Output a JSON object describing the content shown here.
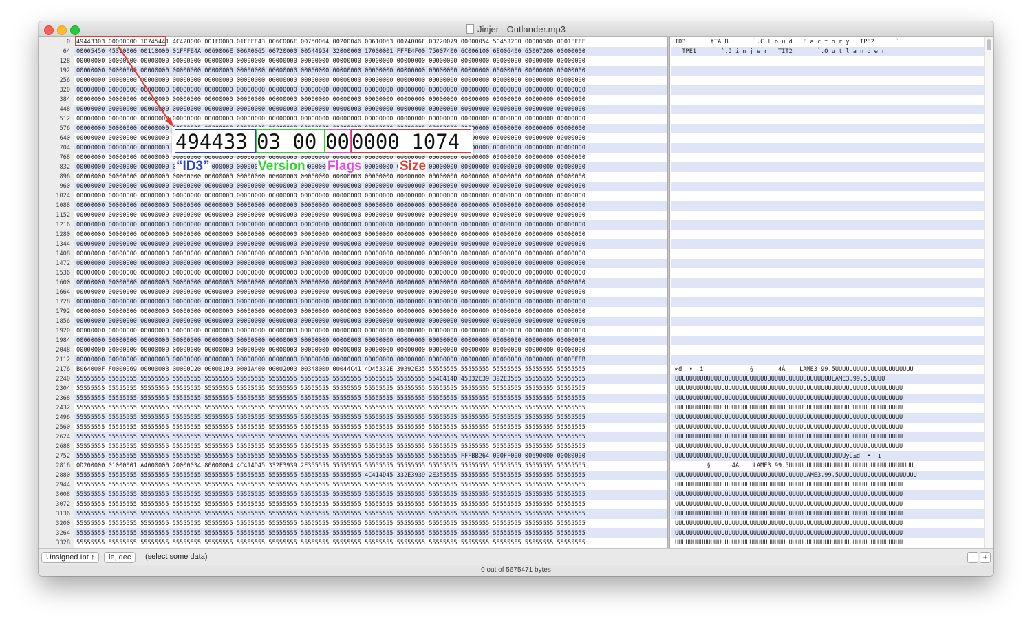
{
  "window": {
    "title": "Jinjer - Outlander.mp3",
    "hex_rows": [
      {
        "offset": "0",
        "hex": "49443303 00000000 10745441 4C420000 001F0000 01FFFE43 006C006F 00750064 00200046 00610063 0074006F 00720079 00000054 50453200 00000500 0001FFFE",
        "ascii": "ID3       tTALB       `.C l o u d   F a c t o r y   TPE2      `."
      },
      {
        "offset": "64",
        "hex": "00005450 45310000 00110000 01FFFE4A 0069006E 006A0065 00720000 00544954 32000000 17000001 FFFE4F00 75007400 6C006100 6E006400 65007200 00000000",
        "ascii": "  TPE1       `.J i n j e r   TIT2       `.O u t l a n d e r"
      },
      {
        "offset": "128",
        "hex": "00000000 00000000 00000000 00000000 00000000 00000000 00000000 00000000 00000000 00000000 00000000 00000000 00000000 00000000 00000000 00000000",
        "ascii": ""
      },
      {
        "offset": "192",
        "hex": "00000000 00000000 00000000 00000000 00000000 00000000 00000000 00000000 00000000 00000000 00000000 00000000 00000000 00000000 00000000 00000000",
        "ascii": ""
      },
      {
        "offset": "256",
        "hex": "00000000 00000000 00000000 00000000 00000000 00000000 00000000 00000000 00000000 00000000 00000000 00000000 00000000 00000000 00000000 00000000",
        "ascii": ""
      },
      {
        "offset": "320",
        "hex": "00000000 00000000 00000000 00000000 00000000 00000000 00000000 00000000 00000000 00000000 00000000 00000000 00000000 00000000 00000000 00000000",
        "ascii": ""
      },
      {
        "offset": "384",
        "hex": "00000000 00000000 00000000 00000000 00000000 00000000 00000000 00000000 00000000 00000000 00000000 00000000 00000000 00000000 00000000 00000000",
        "ascii": ""
      },
      {
        "offset": "448",
        "hex": "00000000 00000000 00000000 00000000 00000000 00000000 00000000 00000000 00000000 00000000 00000000 00000000 00000000 00000000 00000000 00000000",
        "ascii": ""
      },
      {
        "offset": "512",
        "hex": "00000000 00000000 00000000 00000000 00000000 00000000 00000000 00000000 00000000 00000000 00000000 00000000 00000000 00000000 00000000 00000000",
        "ascii": ""
      },
      {
        "offset": "576",
        "hex": "00000000 00000000 00000000 00000000 00000000 00000000 00000000 00000000 00000000 00000000 00000000 00000000 00000000 00000000 00000000 00000000",
        "ascii": ""
      },
      {
        "offset": "640",
        "hex": "00000000 00000000 00000000 00000000 00000000 00000000 00000000 00000000 00000000 00000000 00000000 00000000 00000000 00000000 00000000 00000000",
        "ascii": ""
      },
      {
        "offset": "704",
        "hex": "00000000 00000000 00000000 00000000 00000000 00000000 00000000 00000000 00000000 00000000 00000000 00000000 00000000 00000000 00000000 00000000",
        "ascii": ""
      },
      {
        "offset": "768",
        "hex": "00000000 00000000 00000000 00000000 00000000 00000000 00000000 00000000 00000000 00000000 00000000 00000000 00000000 00000000 00000000 00000000",
        "ascii": ""
      },
      {
        "offset": "832",
        "hex": "00000000 00000000 00000000 00000000 00000000 00000000 00000000 00000000 00000000 00000000 00000000 00000000 00000000 00000000 00000000 00000000",
        "ascii": ""
      },
      {
        "offset": "896",
        "hex": "00000000 00000000 00000000 00000000 00000000 00000000 00000000 00000000 00000000 00000000 00000000 00000000 00000000 00000000 00000000 00000000",
        "ascii": ""
      },
      {
        "offset": "960",
        "hex": "00000000 00000000 00000000 00000000 00000000 00000000 00000000 00000000 00000000 00000000 00000000 00000000 00000000 00000000 00000000 00000000",
        "ascii": ""
      },
      {
        "offset": "1024",
        "hex": "00000000 00000000 00000000 00000000 00000000 00000000 00000000 00000000 00000000 00000000 00000000 00000000 00000000 00000000 00000000 00000000",
        "ascii": ""
      },
      {
        "offset": "1088",
        "hex": "00000000 00000000 00000000 00000000 00000000 00000000 00000000 00000000 00000000 00000000 00000000 00000000 00000000 00000000 00000000 00000000",
        "ascii": ""
      },
      {
        "offset": "1152",
        "hex": "00000000 00000000 00000000 00000000 00000000 00000000 00000000 00000000 00000000 00000000 00000000 00000000 00000000 00000000 00000000 00000000",
        "ascii": ""
      },
      {
        "offset": "1216",
        "hex": "00000000 00000000 00000000 00000000 00000000 00000000 00000000 00000000 00000000 00000000 00000000 00000000 00000000 00000000 00000000 00000000",
        "ascii": ""
      },
      {
        "offset": "1280",
        "hex": "00000000 00000000 00000000 00000000 00000000 00000000 00000000 00000000 00000000 00000000 00000000 00000000 00000000 00000000 00000000 00000000",
        "ascii": ""
      },
      {
        "offset": "1344",
        "hex": "00000000 00000000 00000000 00000000 00000000 00000000 00000000 00000000 00000000 00000000 00000000 00000000 00000000 00000000 00000000 00000000",
        "ascii": ""
      },
      {
        "offset": "1408",
        "hex": "00000000 00000000 00000000 00000000 00000000 00000000 00000000 00000000 00000000 00000000 00000000 00000000 00000000 00000000 00000000 00000000",
        "ascii": ""
      },
      {
        "offset": "1472",
        "hex": "00000000 00000000 00000000 00000000 00000000 00000000 00000000 00000000 00000000 00000000 00000000 00000000 00000000 00000000 00000000 00000000",
        "ascii": ""
      },
      {
        "offset": "1536",
        "hex": "00000000 00000000 00000000 00000000 00000000 00000000 00000000 00000000 00000000 00000000 00000000 00000000 00000000 00000000 00000000 00000000",
        "ascii": ""
      },
      {
        "offset": "1600",
        "hex": "00000000 00000000 00000000 00000000 00000000 00000000 00000000 00000000 00000000 00000000 00000000 00000000 00000000 00000000 00000000 00000000",
        "ascii": ""
      },
      {
        "offset": "1664",
        "hex": "00000000 00000000 00000000 00000000 00000000 00000000 00000000 00000000 00000000 00000000 00000000 00000000 00000000 00000000 00000000 00000000",
        "ascii": ""
      },
      {
        "offset": "1728",
        "hex": "00000000 00000000 00000000 00000000 00000000 00000000 00000000 00000000 00000000 00000000 00000000 00000000 00000000 00000000 00000000 00000000",
        "ascii": ""
      },
      {
        "offset": "1792",
        "hex": "00000000 00000000 00000000 00000000 00000000 00000000 00000000 00000000 00000000 00000000 00000000 00000000 00000000 00000000 00000000 00000000",
        "ascii": ""
      },
      {
        "offset": "1856",
        "hex": "00000000 00000000 00000000 00000000 00000000 00000000 00000000 00000000 00000000 00000000 00000000 00000000 00000000 00000000 00000000 00000000",
        "ascii": ""
      },
      {
        "offset": "1920",
        "hex": "00000000 00000000 00000000 00000000 00000000 00000000 00000000 00000000 00000000 00000000 00000000 00000000 00000000 00000000 00000000 00000000",
        "ascii": ""
      },
      {
        "offset": "1984",
        "hex": "00000000 00000000 00000000 00000000 00000000 00000000 00000000 00000000 00000000 00000000 00000000 00000000 00000000 00000000 00000000 00000000",
        "ascii": ""
      },
      {
        "offset": "2048",
        "hex": "00000000 00000000 00000000 00000000 00000000 00000000 00000000 00000000 00000000 00000000 00000000 00000000 00000000 00000000 00000000 00000000",
        "ascii": ""
      },
      {
        "offset": "2112",
        "hex": "00000000 00000000 00000000 00000000 00000000 00000000 00000000 00000000 00000000 00000000 00000000 00000000 00000000 00000000 00000000 0000FFFB",
        "ascii": ""
      },
      {
        "offset": "2176",
        "hex": "B064000F F0000069 00000008 00000D20 00000100 0001A400 00002000 00348000 00044C41 4D45332E 39392E35 55555555 55555555 55555555 55555555 55555555",
        "ascii": "∞d  •  i             §       4À    LAME3.99.5UUUUUUUUUUUUUUUUUUUUUU"
      },
      {
        "offset": "2240",
        "hex": "55555555 55555555 55555555 55555555 55555555 55555555 55555555 55555555 55555555 55555555 55555555 554C414D 45332E39 392E3555 55555555 55555555",
        "ascii": "UUUUUUUUUUUUUUUUUUUUUUUUUUUUUUUUUUUUUUUUUUUULAME3.99.5UUUUU"
      },
      {
        "offset": "2304",
        "hex": "55555555 55555555 55555555 55555555 55555555 55555555 55555555 55555555 55555555 55555555 55555555 55555555 55555555 55555555 55555555 55555555",
        "ascii": "UUUUUUUUUUUUUUUUUUUUUUUUUUUUUUUUUUUUUUUUUUUUUUUUUUUUUUUUUUUUUUUU"
      },
      {
        "offset": "2368",
        "hex": "55555555 55555555 55555555 55555555 55555555 55555555 55555555 55555555 55555555 55555555 55555555 55555555 55555555 55555555 55555555 55555555",
        "ascii": "UUUUUUUUUUUUUUUUUUUUUUUUUUUUUUUUUUUUUUUUUUUUUUUUUUUUUUUUUUUUUUUU"
      },
      {
        "offset": "2432",
        "hex": "55555555 55555555 55555555 55555555 55555555 55555555 55555555 55555555 55555555 55555555 55555555 55555555 55555555 55555555 55555555 55555555",
        "ascii": "UUUUUUUUUUUUUUUUUUUUUUUUUUUUUUUUUUUUUUUUUUUUUUUUUUUUUUUUUUUUUUUU"
      },
      {
        "offset": "2496",
        "hex": "55555555 55555555 55555555 55555555 55555555 55555555 55555555 55555555 55555555 55555555 55555555 55555555 55555555 55555555 55555555 55555555",
        "ascii": "UUUUUUUUUUUUUUUUUUUUUUUUUUUUUUUUUUUUUUUUUUUUUUUUUUUUUUUUUUUUUUUU"
      },
      {
        "offset": "2560",
        "hex": "55555555 55555555 55555555 55555555 55555555 55555555 55555555 55555555 55555555 55555555 55555555 55555555 55555555 55555555 55555555 55555555",
        "ascii": "UUUUUUUUUUUUUUUUUUUUUUUUUUUUUUUUUUUUUUUUUUUUUUUUUUUUUUUUUUUUUUUU"
      },
      {
        "offset": "2624",
        "hex": "55555555 55555555 55555555 55555555 55555555 55555555 55555555 55555555 55555555 55555555 55555555 55555555 55555555 55555555 55555555 55555555",
        "ascii": "UUUUUUUUUUUUUUUUUUUUUUUUUUUUUUUUUUUUUUUUUUUUUUUUUUUUUUUUUUUUUUUU"
      },
      {
        "offset": "2688",
        "hex": "55555555 55555555 55555555 55555555 55555555 55555555 55555555 55555555 55555555 55555555 55555555 55555555 55555555 55555555 55555555 55555555",
        "ascii": "UUUUUUUUUUUUUUUUUUUUUUUUUUUUUUUUUUUUUUUUUUUUUUUUUUUUUUUUUUUUUUUU"
      },
      {
        "offset": "2752",
        "hex": "55555555 55555555 55555555 55555555 55555555 55555555 55555555 55555555 55555555 55555555 55555555 55555555 FFFBB264 000FF000 00690000 00080000",
        "ascii": "UUUUUUUUUUUUUUUUUUUUUUUUUUUUUUUUUUUUUUUUUUUUUUUUÿû≤d  •  i"
      },
      {
        "offset": "2816",
        "hex": "0D200000 01000001 A4000000 20000034 80000004 4C414D45 332E3939 2E355555 55555555 55555555 55555555 55555555 55555555 55555555 55555555 55555555",
        "ascii": "         §      4À    LAME3.99.5UUUUUUUUUUUUUUUUUUUUUUUUUUUUUUUUUUU"
      },
      {
        "offset": "2880",
        "hex": "55555555 55555555 55555555 55555555 55555555 55555555 55555555 55555555 55555555 4C414D45 332E3939 2E355555 55555555 55555555 55555555 55555555",
        "ascii": "UUUUUUUUUUUUUUUUUUUUUUUUUUUUUUUUUUUULAME3.99.5UUUUUUUUUUUUUUUUUUUUUU"
      },
      {
        "offset": "2944",
        "hex": "55555555 55555555 55555555 55555555 55555555 55555555 55555555 55555555 55555555 55555555 55555555 55555555 55555555 55555555 55555555 55555555",
        "ascii": "UUUUUUUUUUUUUUUUUUUUUUUUUUUUUUUUUUUUUUUUUUUUUUUUUUUUUUUUUUUUUUUU"
      },
      {
        "offset": "3008",
        "hex": "55555555 55555555 55555555 55555555 55555555 55555555 55555555 55555555 55555555 55555555 55555555 55555555 55555555 55555555 55555555 55555555",
        "ascii": "UUUUUUUUUUUUUUUUUUUUUUUUUUUUUUUUUUUUUUUUUUUUUUUUUUUUUUUUUUUUUUUU"
      },
      {
        "offset": "3072",
        "hex": "55555555 55555555 55555555 55555555 55555555 55555555 55555555 55555555 55555555 55555555 55555555 55555555 55555555 55555555 55555555 55555555",
        "ascii": "UUUUUUUUUUUUUUUUUUUUUUUUUUUUUUUUUUUUUUUUUUUUUUUUUUUUUUUUUUUUUUUU"
      },
      {
        "offset": "3136",
        "hex": "55555555 55555555 55555555 55555555 55555555 55555555 55555555 55555555 55555555 55555555 55555555 55555555 55555555 55555555 55555555 55555555",
        "ascii": "UUUUUUUUUUUUUUUUUUUUUUUUUUUUUUUUUUUUUUUUUUUUUUUUUUUUUUUUUUUUUUUU"
      },
      {
        "offset": "3200",
        "hex": "55555555 55555555 55555555 55555555 55555555 55555555 55555555 55555555 55555555 55555555 55555555 55555555 55555555 55555555 55555555 55555555",
        "ascii": "UUUUUUUUUUUUUUUUUUUUUUUUUUUUUUUUUUUUUUUUUUUUUUUUUUUUUUUUUUUUUUUU"
      },
      {
        "offset": "3264",
        "hex": "55555555 55555555 55555555 55555555 55555555 55555555 55555555 55555555 55555555 55555555 55555555 55555555 55555555 55555555 55555555 55555555",
        "ascii": "UUUUUUUUUUUUUUUUUUUUUUUUUUUUUUUUUUUUUUUUUUUUUUUUUUUUUUUUUUUUUUUU"
      },
      {
        "offset": "3328",
        "hex": "55555555 55555555 55555555 55555555 55555555 55555555 55555555 55555555 55555555 55555555 55555555 55555555 55555555 55555555 55555555 55555555",
        "ascii": "UUUUUUUUUUUUUUUUUUUUUUUUUUUUUUUUUUUUUUUUUUUUUUUUUUUUUUUUUUUUUUUU"
      }
    ],
    "bottombar": {
      "type_popup": "Unsigned Int ↕",
      "endian_popup": "le, dec",
      "selection_status": "(select some data)",
      "minus_label": "−",
      "plus_label": "+"
    },
    "status": "0 out of 5675471 bytes"
  },
  "annotation": {
    "zoom": {
      "id3_bytes": "494433",
      "version_bytes": "03 00",
      "flags_bytes": "00",
      "size_bytes": "0000 1074"
    },
    "labels": {
      "id3": "“ID3”",
      "version": "Version",
      "flags": "Flags",
      "size": "Size"
    },
    "colors": {
      "id3": "#2541d6",
      "version": "#2fd52f",
      "flags": "#e64ae6",
      "size": "#e83a30"
    }
  }
}
